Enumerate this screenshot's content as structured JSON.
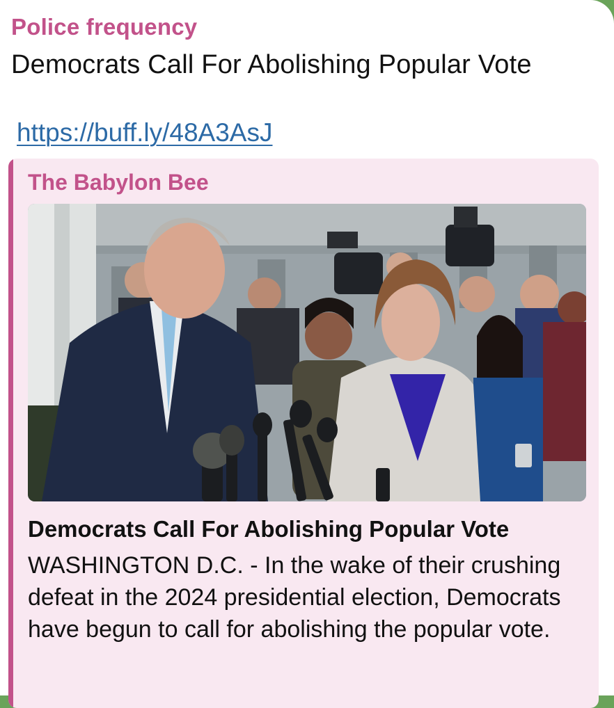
{
  "message": {
    "sender": "Police frequency",
    "text": "Democrats Call For Abolishing Popular Vote",
    "link": "https://buff.ly/48A3AsJ"
  },
  "link_preview": {
    "site_name": "The Babylon Bee",
    "title": "Democrats Call For Abolishing Popular Vote",
    "description": "WASHINGTON D.C. - In the wake of their crushing defeat in the 2024 presidential election, Democrats have begun to call for abolishing the popular vote."
  },
  "colors": {
    "accent": "#c2528a",
    "link": "#2c6aa6",
    "preview_background": "#f9e8f1",
    "chat_background": "#6aa35a"
  }
}
